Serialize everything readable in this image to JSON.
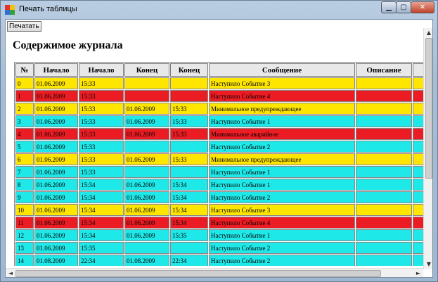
{
  "window": {
    "title": "Печать таблицы",
    "minimize_glyph": "▁",
    "maximize_glyph": "▢",
    "close_glyph": "✕"
  },
  "toolbar": {
    "print_label": "Печатать"
  },
  "heading": "Содержимое журнала",
  "table": {
    "headers": [
      "№",
      "Начало",
      "Начало",
      "Конец",
      "Конец",
      "Сообщение",
      "Описание",
      ""
    ],
    "rows": [
      {
        "color": "yellow",
        "cells": [
          "0",
          "01.06.2009",
          "15:33",
          "",
          "",
          "Наступило Событие 3",
          "",
          ""
        ]
      },
      {
        "color": "red",
        "cells": [
          "1",
          "01.06.2009",
          "15:33",
          "",
          "",
          "Наступило Событие 4",
          "",
          ""
        ]
      },
      {
        "color": "yellow",
        "cells": [
          "2",
          "01.06.2009",
          "15:33",
          "01.06.2009",
          "15:33",
          "Минимальное предупреждающее",
          "",
          ""
        ]
      },
      {
        "color": "cyan",
        "cells": [
          "3",
          "01.06.2009",
          "15:33",
          "01.06.2009",
          "15:33",
          "Наступило Событие 1",
          "",
          ""
        ]
      },
      {
        "color": "red",
        "cells": [
          "4",
          "01.06.2009",
          "15:33",
          "01.06.2009",
          "15:33",
          "Минимальное аварийное",
          "",
          ""
        ]
      },
      {
        "color": "cyan",
        "cells": [
          "5",
          "01.06.2009",
          "15:33",
          "",
          "",
          "Наступило Событие 2",
          "",
          ""
        ]
      },
      {
        "color": "yellow",
        "cells": [
          "6",
          "01.06.2009",
          "15:33",
          "01.06.2009",
          "15:33",
          "Минимальное предупреждающее",
          "",
          ""
        ]
      },
      {
        "color": "cyan",
        "cells": [
          "7",
          "01.06.2009",
          "15:33",
          "",
          "",
          "Наступило Событие 1",
          "",
          ""
        ]
      },
      {
        "color": "cyan",
        "cells": [
          "8",
          "01.06.2009",
          "15:34",
          "01.06.2009",
          "15:34",
          "Наступило Событие 1",
          "",
          ""
        ]
      },
      {
        "color": "cyan",
        "cells": [
          "9",
          "01.06.2009",
          "15:34",
          "01.06.2009",
          "15:34",
          "Наступило Событие 2",
          "",
          ""
        ]
      },
      {
        "color": "yellow",
        "cells": [
          "10",
          "01.06.2009",
          "15:34",
          "01.06.2009",
          "15:34",
          "Наступило Событие 3",
          "",
          ""
        ]
      },
      {
        "color": "red",
        "cells": [
          "11",
          "01.06.2009",
          "15:34",
          "01.06.2009",
          "15:34",
          "Наступило Событие 4",
          "",
          ""
        ]
      },
      {
        "color": "cyan",
        "cells": [
          "12",
          "01.06.2009",
          "15:34",
          "01.06.2009",
          "15:35",
          "Наступило Событие 1",
          "",
          ""
        ]
      },
      {
        "color": "cyan",
        "cells": [
          "13",
          "01.06.2009",
          "15:35",
          "",
          "",
          "Наступило Событие 2",
          "",
          ""
        ]
      },
      {
        "color": "cyan",
        "cells": [
          "14",
          "01.08.2009",
          "22:34",
          "01.08.2009",
          "22:34",
          "Наступило Событие 2",
          "",
          ""
        ]
      }
    ]
  },
  "colors": {
    "yellow": "#ffe600",
    "red": "#ec1c24",
    "cyan": "#1fe8e8"
  },
  "icons": {
    "app": "app-icon",
    "scroll_up": "▲",
    "scroll_down": "▼",
    "scroll_left": "◄",
    "scroll_right": "►"
  }
}
